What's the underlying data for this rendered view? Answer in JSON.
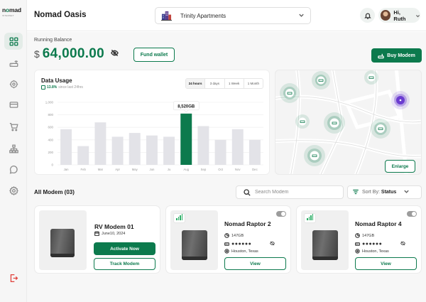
{
  "brand": {
    "name_prefix": "n",
    "name_o": "o",
    "name_suffix": "mad",
    "tagline": "INTERNET"
  },
  "header": {
    "title": "Nomad Oasis",
    "location": "Trinity Apartments",
    "greeting": "Hi, Ruth"
  },
  "sidebar": {
    "items": [
      {
        "name": "dashboard",
        "icon": "dashboard-icon",
        "active": true
      },
      {
        "name": "modems",
        "icon": "router-icon"
      },
      {
        "name": "location",
        "icon": "target-icon"
      },
      {
        "name": "payments",
        "icon": "card-icon"
      },
      {
        "name": "shop",
        "icon": "cart-icon"
      },
      {
        "name": "network",
        "icon": "network-icon"
      },
      {
        "name": "support",
        "icon": "chat-icon"
      },
      {
        "name": "settings",
        "icon": "gear-icon"
      }
    ],
    "logout_icon": "logout-icon"
  },
  "balance": {
    "label": "Running Balance",
    "currency": "$",
    "amount": "64,000.00",
    "fund_label": "Fund wallet"
  },
  "buy_modem_label": "Buy Modem",
  "usage": {
    "title": "Data Usage",
    "change": "13.8%",
    "since": "since last 24hrs",
    "ranges": [
      "24 hours",
      "3 days",
      "1 Week",
      "1 Month"
    ],
    "active_range": "24 hours"
  },
  "chart_data": {
    "type": "bar",
    "title": "Data Usage",
    "categories": [
      "Jan",
      "Feb",
      "Mar",
      "Apr",
      "May",
      "Jun",
      "Ju",
      "Aug",
      "Sep",
      "Oct",
      "Nov",
      "Dec"
    ],
    "values": [
      570,
      300,
      680,
      450,
      510,
      470,
      450,
      820,
      620,
      400,
      570,
      400
    ],
    "highlight_index": 7,
    "highlight_label": "8,520GB",
    "ylim": [
      0,
      1000
    ],
    "yticks": [
      "0",
      "200",
      "400",
      "600",
      "800",
      "1,000"
    ],
    "highlight_color": "#0c7a4d",
    "bar_color": "#e3e3e8",
    "grid": true
  },
  "map": {
    "enlarge_label": "Enlarge"
  },
  "modems": {
    "heading": "All Modem (03)",
    "search_placeholder": "Search Modem",
    "sort_label": "Sort By:",
    "sort_value": "Status",
    "items": [
      {
        "name": "RV Modem  01",
        "date": "June10, 2024",
        "primary_action": "Activate Now",
        "secondary_action": "Track Modem"
      },
      {
        "name": "Nomad Raptor 2",
        "data": "147GB",
        "password": "●●●●●●",
        "location": "Houston, Texas",
        "action": "View"
      },
      {
        "name": "Nomad Raptor 4",
        "data": "147GB",
        "password": "●●●●●●",
        "location": "Houston, Texas",
        "action": "View"
      }
    ]
  }
}
